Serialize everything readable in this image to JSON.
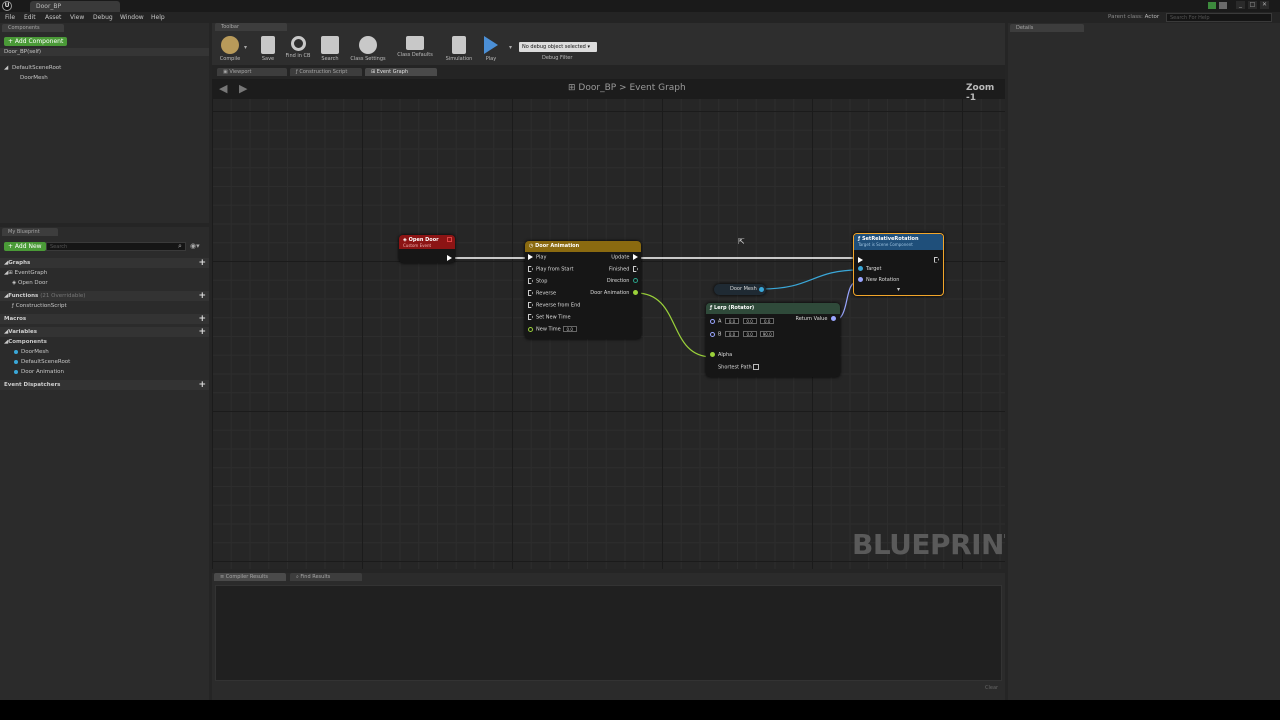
{
  "window": {
    "doc_tab": "Door_BP",
    "parent_class_label": "Parent class:",
    "parent_class_value": "Actor",
    "help_search_placeholder": "Search For Help"
  },
  "menu": [
    "File",
    "Edit",
    "Asset",
    "View",
    "Debug",
    "Window",
    "Help"
  ],
  "components": {
    "tab": "Components",
    "add_button": "+ Add Component",
    "self_item": "Door_BP(self)",
    "tree": [
      "DefaultSceneRoot",
      "DoorMesh"
    ]
  },
  "my_blueprint": {
    "tab": "My Blueprint",
    "add_new": "+ Add New",
    "search_placeholder": "Search",
    "graphs_label": "Graphs",
    "event_graph": "EventGraph",
    "open_door": "Open Door",
    "functions_label": "Functions",
    "functions_count": "(21 Overridable)",
    "construction_script": "ConstructionScript",
    "macros_label": "Macros",
    "variables_label": "Variables",
    "components_label": "Components",
    "component_items": [
      "DoorMesh",
      "DefaultSceneRoot",
      "Door Animation"
    ],
    "event_dispatchers_label": "Event Dispatchers"
  },
  "toolbar": {
    "tab": "Toolbar",
    "compile": "Compile",
    "save": "Save",
    "find_in_cb": "Find in CB",
    "search": "Search",
    "class_settings": "Class Settings",
    "class_defaults": "Class Defaults",
    "simulation": "Simulation",
    "play": "Play",
    "debug_object": "No debug object selected",
    "debug_filter": "Debug Filter"
  },
  "graph_tabs": [
    "Viewport",
    "Construction Script",
    "Event Graph"
  ],
  "graph": {
    "breadcrumb_root": "Door_BP",
    "breadcrumb_sep": ">",
    "breadcrumb_current": "Event Graph",
    "zoom": "Zoom -1",
    "watermark": "BLUEPRINT",
    "nodes": {
      "open_door": {
        "title": "Open Door",
        "subtitle": "Custom Event"
      },
      "timeline": {
        "title": "Door Animation",
        "inputs": [
          "Play",
          "Play from Start",
          "Stop",
          "Reverse",
          "Reverse from End",
          "Set New Time"
        ],
        "new_time_label": "New Time",
        "new_time_value": "0.0",
        "outputs": [
          "Update",
          "Finished",
          "Direction",
          "Door Animation"
        ]
      },
      "door_mesh_var": {
        "label": "Door Mesh"
      },
      "lerp": {
        "title": "Lerp (Rotator)",
        "a_label": "A",
        "a_values": [
          "0.0",
          "0.0",
          "0.0"
        ],
        "b_label": "B",
        "b_values": [
          "0.0",
          "0.0",
          "90.0"
        ],
        "alpha": "Alpha",
        "shortest_path": "Shortest Path",
        "return_value": "Return Value"
      },
      "set_rotation": {
        "title": "SetRelativeRotation",
        "subtitle": "Target is Scene Component",
        "target": "Target",
        "new_rotation": "New Rotation"
      }
    }
  },
  "bottom_tabs": [
    "Compiler Results",
    "Find Results"
  ],
  "bottom_clear": "Clear",
  "details": {
    "tab": "Details"
  },
  "colors": {
    "event_header": "#8c1414",
    "timeline_header": "#8a6a10",
    "function_header": "#1f4f7a",
    "exec_wire": "#ffffff",
    "float_wire": "#9ad13a",
    "object_wire": "#3aa7d8",
    "rotator_pin": "#9aa6ff",
    "selection": "#f2a62b",
    "add_green": "#4a9a37"
  }
}
